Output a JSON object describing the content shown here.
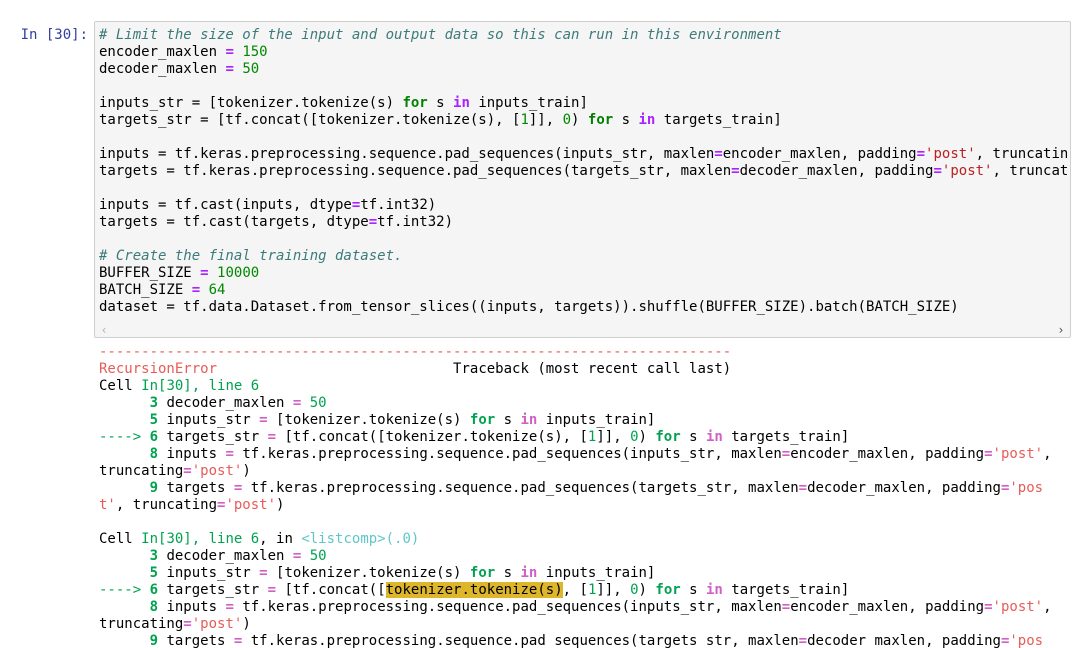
{
  "prompt": {
    "label": "In [30]:"
  },
  "code": {
    "l1_comment": "# Limit the size of the input and output data so this can run in this environment",
    "l2_name": "encoder_maxlen",
    "l2_val": "150",
    "l3_name": "decoder_maxlen",
    "l3_val": "50",
    "l5_a": "inputs_str = [tokenizer.tokenize(s) ",
    "l5_b": " s ",
    "l5_c": " inputs_train]",
    "l6_a": "targets_str = [tf.concat([tokenizer.tokenize(s), [",
    "l6_num1": "1",
    "l6_b": "]], ",
    "l6_num2": "0",
    "l6_c": ") ",
    "l6_d": " s ",
    "l6_e": " targets_train]",
    "l8_a": "inputs = tf.keras.preprocessing.sequence.pad_sequences(inputs_str, maxlen",
    "l8_b": "encoder_maxlen, padding",
    "l8_str": "'post'",
    "l8_c": ", truncating",
    "l9_a": "targets = tf.keras.preprocessing.sequence.pad_sequences(targets_str, maxlen",
    "l9_b": "decoder_maxlen, padding",
    "l9_str": "'post'",
    "l9_c": ", truncati",
    "l11_a": "inputs = tf.cast(inputs, dtype",
    "l11_b": "tf.int32)",
    "l12_a": "targets = tf.cast(targets, dtype",
    "l12_b": "tf.int32)",
    "l14_comment": "# Create the final training dataset.",
    "l15_name": "BUFFER_SIZE",
    "l15_val": "10000",
    "l16_name": "BATCH_SIZE",
    "l16_val": "64",
    "l17": "dataset = tf.data.Dataset.from_tensor_slices((inputs, targets)).shuffle(BUFFER_SIZE).batch(BATCH_SIZE)",
    "kw_for": "for",
    "kw_in": "in",
    "op_eq": "="
  },
  "scrollbar": {
    "left_arrow": "‹",
    "right_arrow": "›"
  },
  "traceback": {
    "dashes": "---------------------------------------------------------------------------",
    "error_name": "RecursionError",
    "header_spacer": "                            ",
    "header_right": "Traceback (most recent call last)",
    "cell_label": "Cell ",
    "cell_ref": "In[30], line 6",
    "cell2_mid": ", in ",
    "listcomp": "<listcomp>(.0)",
    "arrow": "----> ",
    "indent": "      ",
    "ln3": "3",
    "ln5": "5",
    "ln6": "6",
    "ln8": "8",
    "ln9": "9",
    "t3_a": "decoder_maxlen ",
    "t3_b": " 50",
    "t5_a": "inputs_str ",
    "t5_b": " [tokenizer.tokenize(s) ",
    "t5_c": " s ",
    "t5_d": " inputs_train]",
    "t6_a": "targets_str ",
    "t6_b": " [tf.concat([tokenizer.tokenize(s), [",
    "t6_c": "]], ",
    "t6_d": ") ",
    "t6_e": " s ",
    "t6_f": " targets_train]",
    "t6_pre": " [tf.concat([",
    "t6_hl": "tokenizer.tokenize(s)",
    "t6_post": ", [",
    "t8_a": "inputs ",
    "t8_b": " tf.keras.preprocessing.sequence.pad_sequences(inputs_str, maxlen",
    "t8_c": "encoder_maxlen, padding",
    "t8_d": ",",
    "t8_wrap_a": "truncating",
    "t8_wrap_b": ")",
    "t9_a": "targets ",
    "t9_b": " tf.keras.preprocessing.sequence.pad_sequences(targets_str, maxlen",
    "t9_c": "decoder_maxlen, padding",
    "t9_str_head": "'pos",
    "t9_wrap_str": "t'",
    "t9_wrap_b": ", truncating",
    "t9_wrap_c": ")",
    "t9b_a": "targets ",
    "t9b_b": " tf.keras.preprocessing.sequence.pad_sequences(targets_str, maxlen",
    "t9b_c": "decoder_maxlen, padding",
    "s_post": "'post'",
    "n1": "1",
    "n0": "0",
    "n50": " 50",
    "kw_for": "for",
    "kw_in": "in",
    "op_eq": "="
  }
}
